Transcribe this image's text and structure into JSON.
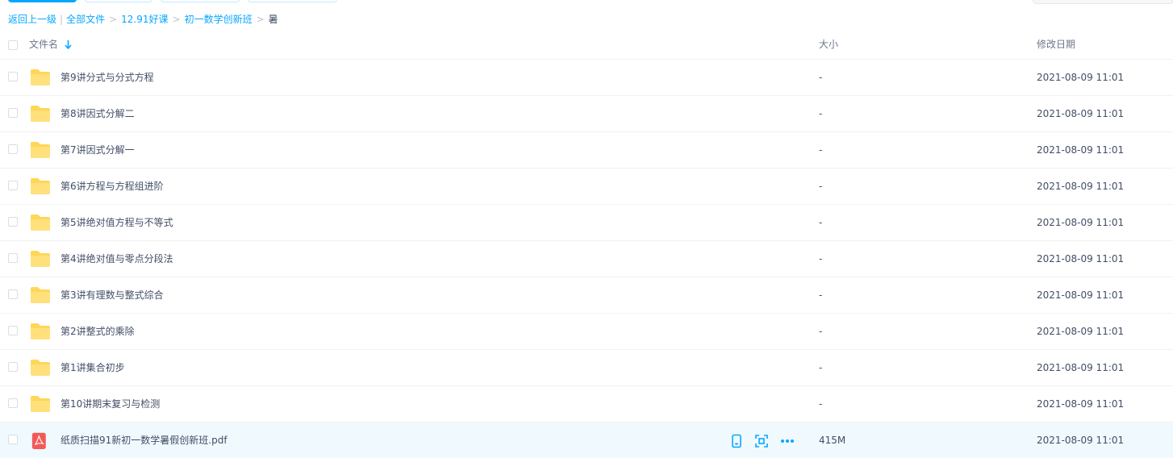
{
  "breadcrumb": {
    "back": "返回上一级",
    "separator": "|",
    "items": [
      "全部文件",
      "12.91好课",
      "初一数学创新班"
    ],
    "current": "暑"
  },
  "header": {
    "name": "文件名",
    "size": "大小",
    "date": "修改日期"
  },
  "files": [
    {
      "name": "第9讲分式与分式方程",
      "size": "-",
      "date": "2021-08-09 11:01",
      "type": "folder"
    },
    {
      "name": "第8讲因式分解二",
      "size": "-",
      "date": "2021-08-09 11:01",
      "type": "folder"
    },
    {
      "name": "第7讲因式分解一",
      "size": "-",
      "date": "2021-08-09 11:01",
      "type": "folder"
    },
    {
      "name": "第6讲方程与方程组进阶",
      "size": "-",
      "date": "2021-08-09 11:01",
      "type": "folder"
    },
    {
      "name": "第5讲绝对值方程与不等式",
      "size": "-",
      "date": "2021-08-09 11:01",
      "type": "folder"
    },
    {
      "name": "第4讲绝对值与零点分段法",
      "size": "-",
      "date": "2021-08-09 11:01",
      "type": "folder"
    },
    {
      "name": "第3讲有理数与整式综合",
      "size": "-",
      "date": "2021-08-09 11:01",
      "type": "folder"
    },
    {
      "name": "第2讲整式的乘除",
      "size": "-",
      "date": "2021-08-09 11:01",
      "type": "folder"
    },
    {
      "name": "第1讲集合初步",
      "size": "-",
      "date": "2021-08-09 11:01",
      "type": "folder"
    },
    {
      "name": "第10讲期末复习与检测",
      "size": "-",
      "date": "2021-08-09 11:01",
      "type": "folder"
    },
    {
      "name": "纸质扫描91新初一数学暑假创新班.pdf",
      "size": "415M",
      "date": "2021-08-09 11:01",
      "type": "pdf"
    }
  ],
  "colors": {
    "accent": "#06a7ff",
    "folder": "#ffd659",
    "pdf": "#f25a5a",
    "highlight_row": "#f0f9fe"
  },
  "icons": {
    "sort": "arrow-down-icon",
    "folder": "folder-icon",
    "pdf": "pdf-icon",
    "row_actions": [
      "mobile-icon",
      "share-scan-icon",
      "more-icon"
    ]
  }
}
